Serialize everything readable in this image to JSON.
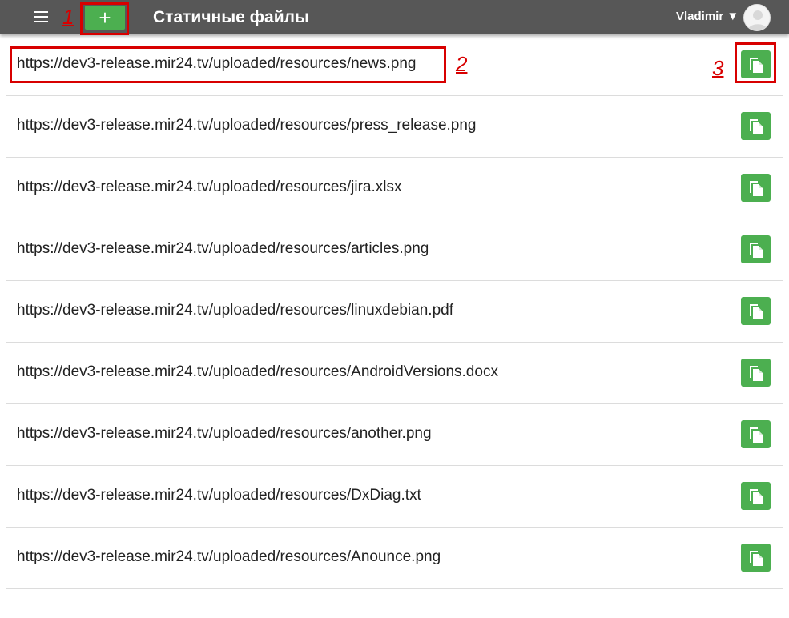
{
  "header": {
    "title": "Статичные файлы",
    "add_label": "+",
    "user_name": "Vladimir ▼",
    "menu_icon": "hamburger-menu-icon",
    "avatar_icon": "user-avatar-icon"
  },
  "annotations": {
    "label_1": "1",
    "label_2": "2",
    "label_3": "3"
  },
  "files": [
    {
      "url": "https://dev3-release.mir24.tv/uploaded/resources/news.png"
    },
    {
      "url": "https://dev3-release.mir24.tv/uploaded/resources/press_release.png"
    },
    {
      "url": "https://dev3-release.mir24.tv/uploaded/resources/jira.xlsx"
    },
    {
      "url": "https://dev3-release.mir24.tv/uploaded/resources/articles.png"
    },
    {
      "url": "https://dev3-release.mir24.tv/uploaded/resources/linuxdebian.pdf"
    },
    {
      "url": "https://dev3-release.mir24.tv/uploaded/resources/AndroidVersions.docx"
    },
    {
      "url": "https://dev3-release.mir24.tv/uploaded/resources/another.png"
    },
    {
      "url": "https://dev3-release.mir24.tv/uploaded/resources/DxDiag.txt"
    },
    {
      "url": "https://dev3-release.mir24.tv/uploaded/resources/Anounce.png"
    }
  ],
  "icons": {
    "copy": "copy-file-icon"
  },
  "colors": {
    "topbar": "#575757",
    "accent_green": "#4caf50",
    "annotation_red": "#d80000"
  }
}
